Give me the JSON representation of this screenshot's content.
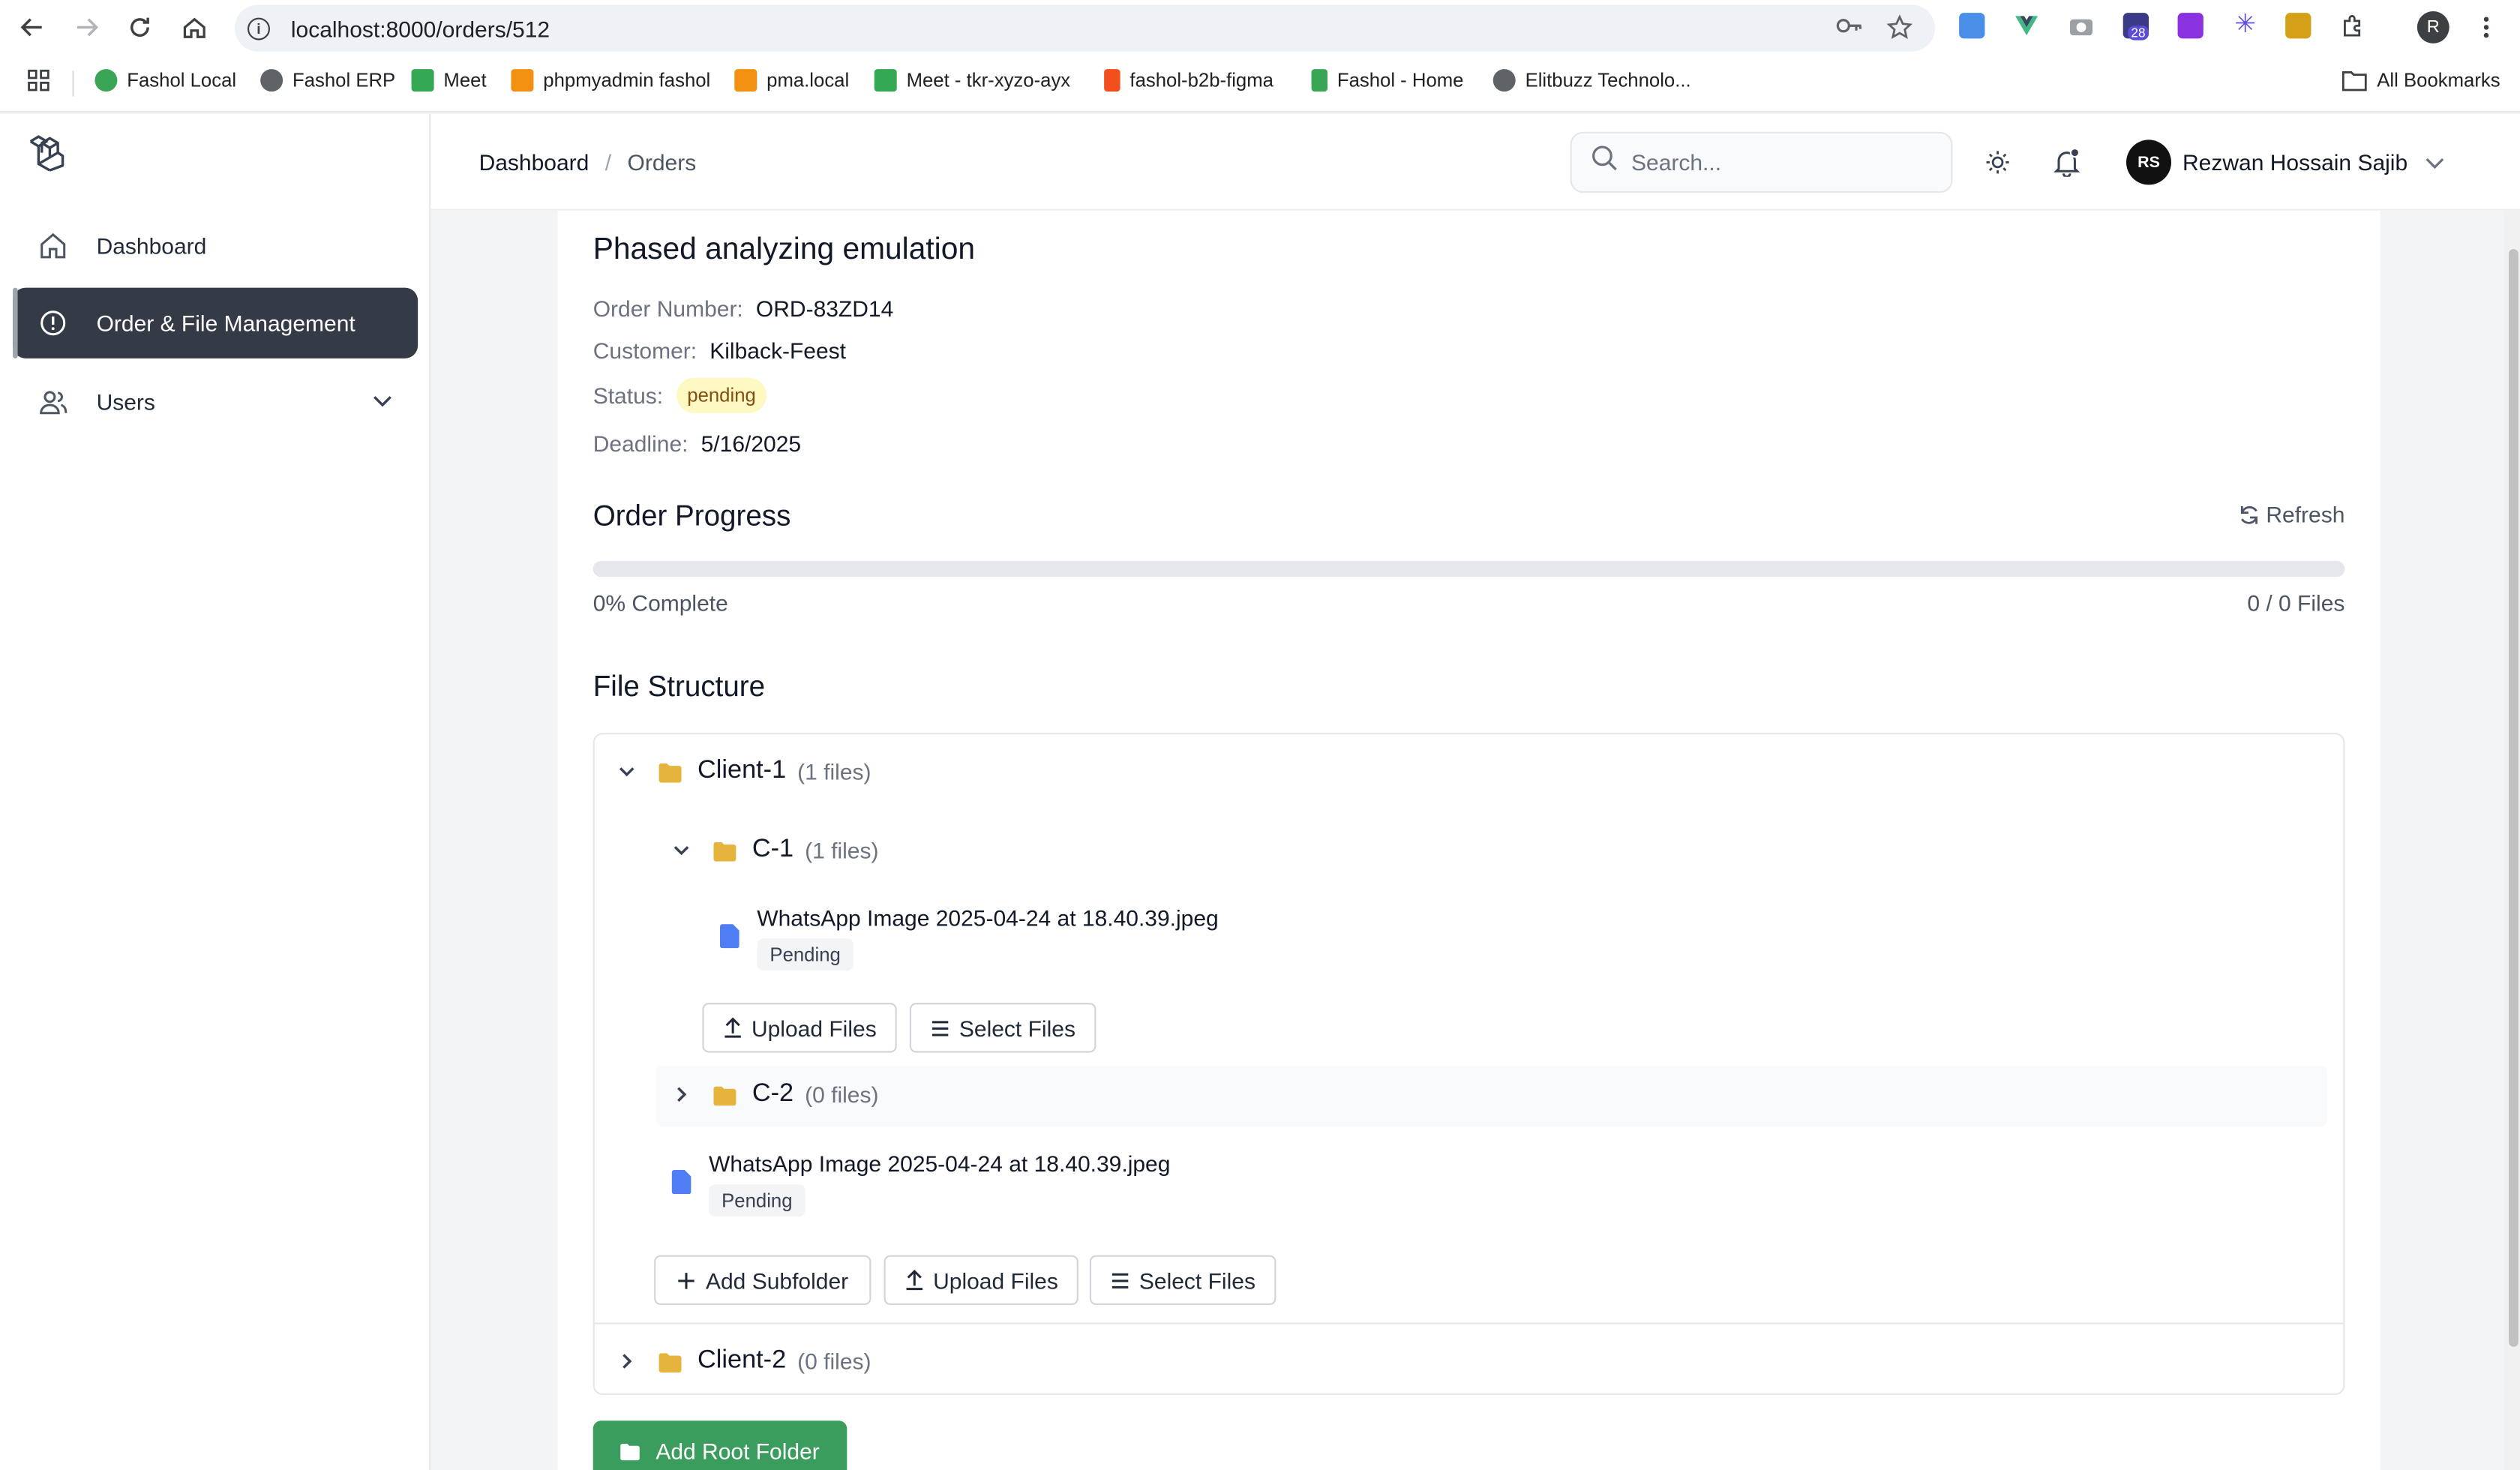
{
  "browser": {
    "url": "localhost:8000/orders/512",
    "extension_badge": "28",
    "profile_initial": "R",
    "bookmarks": [
      "Fashol Local",
      "Fashol ERP",
      "Meet",
      "phpmyadmin fashol",
      "pma.local",
      "Meet - tkr-xyzo-ayx",
      "fashol-b2b-figma",
      "Fashol - Home",
      "Elitbuzz Technolo..."
    ],
    "all_bookmarks": "All Bookmarks"
  },
  "sidebar": {
    "items": [
      {
        "label": "Dashboard",
        "icon": "home-icon"
      },
      {
        "label": "Order & File Management",
        "icon": "alert-circle-icon",
        "active": true
      },
      {
        "label": "Users",
        "icon": "users-icon"
      }
    ]
  },
  "header": {
    "breadcrumb": [
      "Dashboard",
      "Orders"
    ],
    "search_placeholder": "Search...",
    "user_initials": "RS",
    "user_name": "Rezwan Hossain Sajib"
  },
  "order": {
    "title": "Phased analyzing emulation",
    "order_number_label": "Order Number:",
    "order_number": "ORD-83ZD14",
    "customer_label": "Customer:",
    "customer": "Kilback-Feest",
    "status_label": "Status:",
    "status": "pending",
    "deadline_label": "Deadline:",
    "deadline": "5/16/2025"
  },
  "progress": {
    "heading": "Order Progress",
    "refresh_label": "Refresh",
    "percent": 0,
    "complete_text": "0% Complete",
    "files_text": "0 / 0 Files"
  },
  "files": {
    "heading": "File Structure",
    "client1": {
      "name": "Client-1",
      "count": "(1 files)"
    },
    "c1": {
      "name": "C-1",
      "count": "(1 files)"
    },
    "c1_file": {
      "name": "WhatsApp Image 2025-04-24 at 18.40.39.jpeg",
      "status": "Pending"
    },
    "c2": {
      "name": "C-2",
      "count": "(0 files)"
    },
    "client1_file": {
      "name": "WhatsApp Image 2025-04-24 at 18.40.39.jpeg",
      "status": "Pending"
    },
    "client2": {
      "name": "Client-2",
      "count": "(0 files)"
    },
    "upload_label": "Upload Files",
    "select_label": "Select Files",
    "add_subfolder_label": "Add Subfolder",
    "add_root_label": "Add Root Folder"
  },
  "colors": {
    "sidebar_active": "#343a46",
    "pending_badge": "#fef9c3",
    "folder": "#e6b43c",
    "file": "#4f7df3",
    "primary_green": "#3a9d5d"
  }
}
